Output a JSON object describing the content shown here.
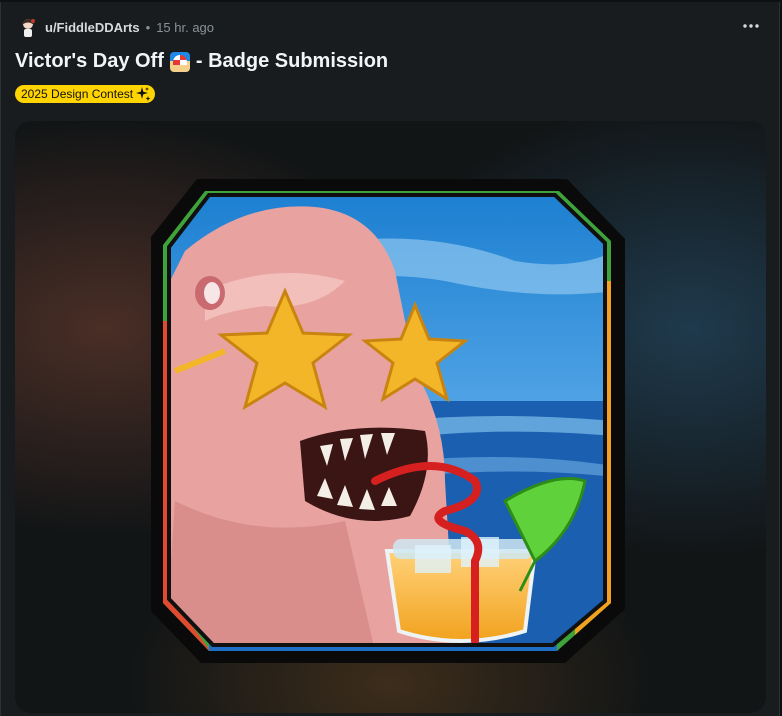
{
  "post": {
    "username": "u/FiddleDDArts",
    "separator": "•",
    "time": "15 hr. ago",
    "title_part1": "Victor's Day Off",
    "title_part2": "- Badge Submission",
    "flair": "2025 Design Contest"
  },
  "colors": {
    "flair_bg": "#ffd400",
    "card_bg": "#181c1f",
    "page_bg": "#0e1113"
  },
  "icons": {
    "avatar": "user-avatar-icon",
    "emoji": "beach-umbrella-emoji-icon",
    "flair": "sparkle-icon",
    "more": "more-options-icon"
  }
}
